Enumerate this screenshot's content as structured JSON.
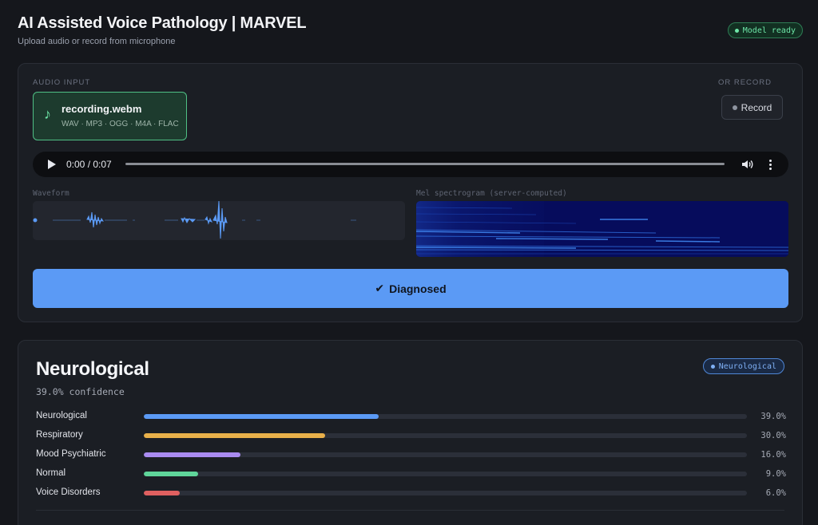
{
  "header": {
    "title": "AI Assisted Voice Pathology | MARVEL",
    "subtitle": "Upload audio or record from microphone",
    "status_badge": "Model ready"
  },
  "input": {
    "audio_input_label": "AUDIO INPUT",
    "or_record_label": "OR RECORD",
    "file_name": "recording.webm",
    "file_types": "WAV · MP3 · OGG · M4A · FLAC",
    "record_button": "Record",
    "player_time": "0:00 / 0:07",
    "waveform_label": "Waveform",
    "spectrogram_label": "Mel spectrogram (server-computed)",
    "diagnose_button": "Diagnosed",
    "diagnose_check": "✔"
  },
  "result": {
    "title": "Neurological",
    "confidence": "39.0% confidence",
    "badge": "Neurological",
    "classes": [
      {
        "name": "Neurological",
        "percent": "39.0%",
        "value": 0.39,
        "color": "#5b9af5"
      },
      {
        "name": "Respiratory",
        "percent": "30.0%",
        "value": 0.3,
        "color": "#e9b04a"
      },
      {
        "name": "Mood Psychiatric",
        "percent": "16.0%",
        "value": 0.16,
        "color": "#a98bf0"
      },
      {
        "name": "Normal",
        "percent": "9.0%",
        "value": 0.09,
        "color": "#5fd59a"
      },
      {
        "name": "Voice Disorders",
        "percent": "6.0%",
        "value": 0.06,
        "color": "#e06060"
      }
    ]
  },
  "colors": {
    "accent": "#5b9af5",
    "ready": "#6ee7a8",
    "background": "#15171c"
  }
}
